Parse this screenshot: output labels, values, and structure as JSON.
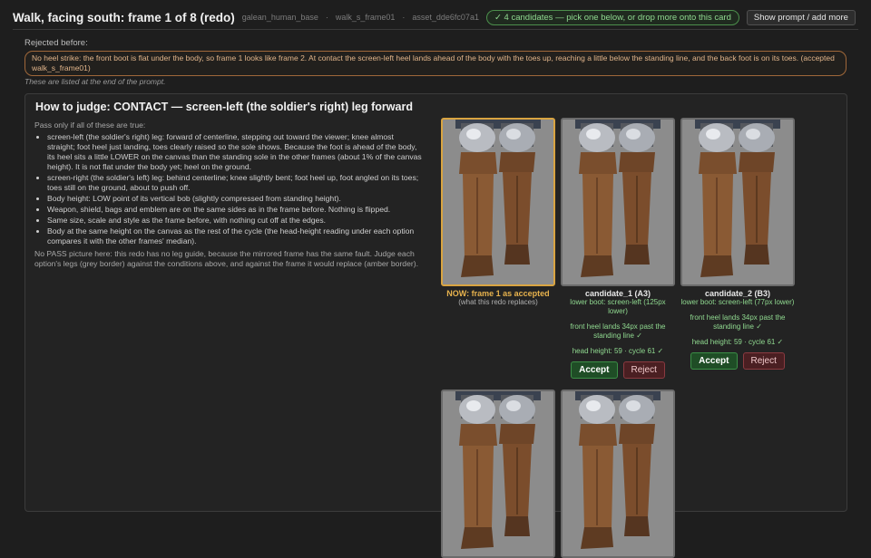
{
  "header": {
    "title": "Walk, facing south: frame 1 of 8 (redo)",
    "rig": "galean_human_base",
    "frame_name": "walk_s_frame01",
    "asset_id": "asset_dde6fc07a1",
    "status": "✓ 4 candidates — pick one below, or drop more onto this card",
    "show_prompt_label": "Show prompt / add more"
  },
  "rejected": {
    "label": "Rejected before:",
    "text": "No heel strike: the front boot is flat under the body, so frame 1 looks like frame 2. At contact the screen-left heel lands ahead of the body with the toes up, reaching a little below the standing line, and the back foot is on its toes. (accepted walk_s_frame01)",
    "listed_note": "These are listed at the end of the prompt."
  },
  "judge": {
    "heading": "How to judge: CONTACT — screen-left (the soldier's right) leg forward",
    "intro": "Pass only if all of these are true:",
    "criteria": [
      "screen-left (the soldier's right) leg: forward of centerline, stepping out toward the viewer; knee almost straight; foot heel just landing, toes clearly raised so the sole shows. Because the foot is ahead of the body, its heel sits a little LOWER on the canvas than the standing sole in the other frames (about 1% of the canvas height). It is not flat under the body yet; heel on the ground.",
      "screen-right (the soldier's left) leg: behind centerline; knee slightly bent; foot heel up, foot angled on its toes; toes still on the ground, about to push off.",
      "Body height: LOW point of its vertical bob (slightly compressed from standing height).",
      "Weapon, shield, bags and emblem are on the same sides as in the frame before. Nothing is flipped.",
      "Same size, scale and style as the frame before, with nothing cut off at the edges.",
      "Body at the same height on the canvas as the rest of the cycle (the head-height reading under each option compares it with the other frames' median)."
    ],
    "footnote": "No PASS picture here: this redo has no leg guide, because the mirrored frame has the same fault. Judge each option's legs (grey border) against the conditions above, and against the frame it would replace (amber border)."
  },
  "current": {
    "caption": "NOW: frame 1 as accepted",
    "sub": "(what this redo replaces)"
  },
  "candidates": [
    {
      "name": "candidate_1 (A3)",
      "boot": "lower boot: screen-left (125px lower)",
      "heel": "front heel lands 34px past the standing line ✓",
      "height": "head height: 59 · cycle 61 ✓",
      "accept": "Accept",
      "reject": "Reject"
    },
    {
      "name": "candidate_2 (B3)",
      "boot": "lower boot: screen-left (77px lower)",
      "heel": "front heel lands 34px past the standing line ✓",
      "height": "head height: 59 · cycle 61 ✓",
      "accept": "Accept",
      "reject": "Reject"
    }
  ],
  "colors": {
    "background": "#1e1e1e",
    "accent_green": "#8fd88f",
    "rejected_amber": "#a0683a",
    "current_frame_border": "#d9a441"
  }
}
